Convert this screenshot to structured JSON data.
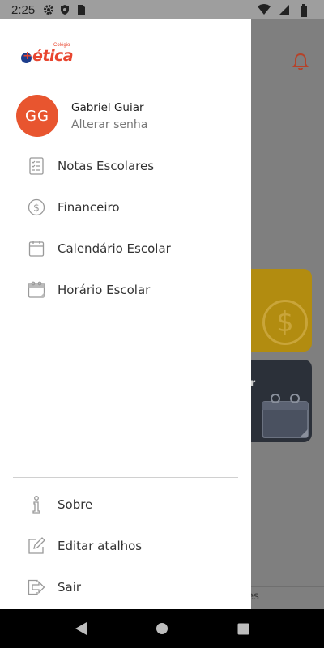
{
  "status_bar": {
    "time": "2:25",
    "left_icons": [
      "gear-icon",
      "shield-icon",
      "sim-card-icon"
    ],
    "right_icons": [
      "wifi-icon",
      "signal-icon",
      "battery-icon"
    ]
  },
  "logo": {
    "brand": "ética",
    "small_text": "Colégio"
  },
  "user": {
    "initials": "GG",
    "name": "Gabriel Guiar",
    "change_password": "Alterar senha",
    "avatar_color": "#e8552f"
  },
  "menu": {
    "items": [
      {
        "label": "Notas Escolares",
        "icon": "report-card-icon"
      },
      {
        "label": "Financeiro",
        "icon": "dollar-circle-icon"
      },
      {
        "label": "Calendário Escolar",
        "icon": "calendar-icon"
      },
      {
        "label": "Horário Escolar",
        "icon": "schedule-calendar-icon"
      }
    ]
  },
  "footer_menu": {
    "items": [
      {
        "label": "Sobre",
        "icon": "info-icon"
      },
      {
        "label": "Editar atalhos",
        "icon": "edit-icon"
      },
      {
        "label": "Sair",
        "icon": "logout-icon"
      }
    ]
  },
  "background": {
    "card_dark_label": "ar",
    "bottom_text": "tes"
  },
  "nav_bar": {
    "buttons": [
      "back-icon",
      "home-icon",
      "recents-icon"
    ]
  },
  "colors": {
    "accent": "#e8552f",
    "bell": "#d9452a",
    "card_yellow": "#f7c31f",
    "card_dark": "#3a4150"
  }
}
